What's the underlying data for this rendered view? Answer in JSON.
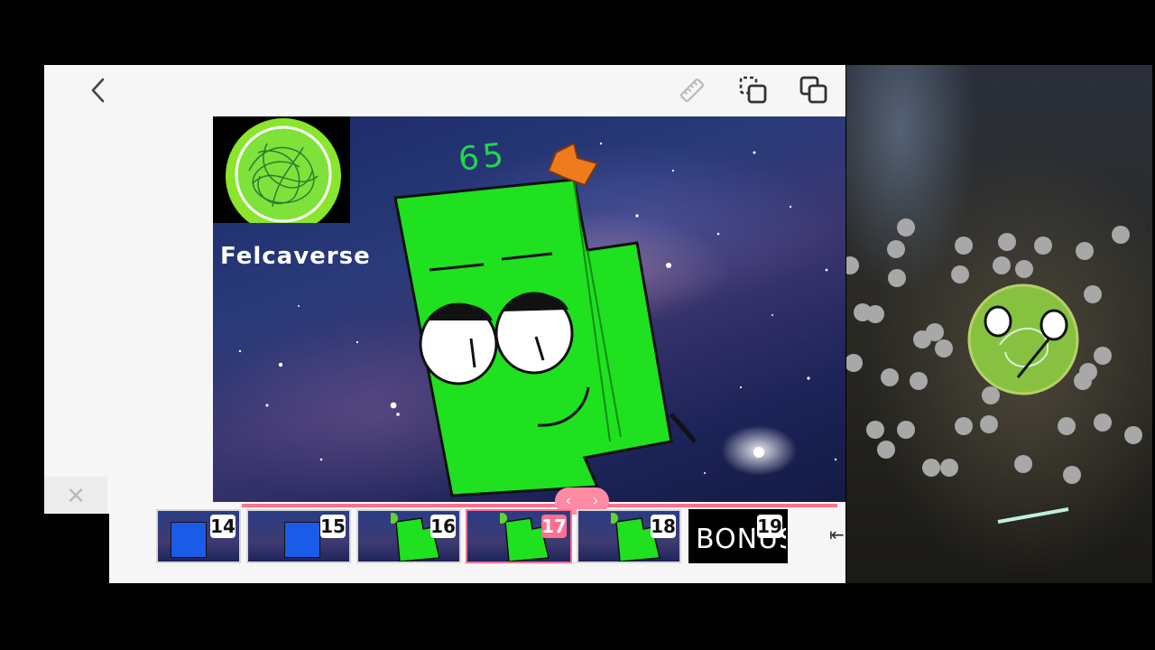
{
  "toolbar": {
    "back_icon": "chevron-left-icon",
    "ruler_icon": "ruler-icon",
    "duplicate_icon": "duplicate-icon",
    "copy_icon": "copy-icon"
  },
  "canvas": {
    "brand_name": "Felcaverse",
    "character_number": "65",
    "colors": {
      "character_green": "#1fe11f",
      "logo_green": "#7fe62a",
      "hat_orange": "#f07a1e"
    }
  },
  "filmstrip": {
    "frames": [
      {
        "number": "14",
        "kind": "blue"
      },
      {
        "number": "15",
        "kind": "blue"
      },
      {
        "number": "16",
        "kind": "green"
      },
      {
        "number": "17",
        "kind": "green",
        "selected": true
      },
      {
        "number": "18",
        "kind": "green"
      },
      {
        "number": "19",
        "kind": "bonus",
        "label": "BONUS"
      }
    ],
    "accent_color": "#ff6f8e",
    "nav_left_icon": "chevron-left-icon",
    "nav_right_icon": "chevron-right-icon",
    "close_icon": "close-icon",
    "skip_end_icon": "skip-to-end-icon"
  }
}
